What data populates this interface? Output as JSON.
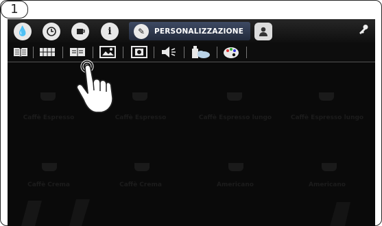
{
  "step_number": "1",
  "header": {
    "tabs": [
      {
        "icon": "water-drop-icon"
      },
      {
        "icon": "clock-icon"
      },
      {
        "icon": "cup-icon"
      },
      {
        "icon": "info-icon"
      }
    ],
    "active_tab": {
      "label": "PERSONALIZZAZIONE",
      "icon": "pencil-icon"
    },
    "user_icon": "user-profile-icon",
    "settings_icon": "wrench-icon"
  },
  "toolbar": {
    "items": [
      {
        "icon": "open-book-icon"
      },
      {
        "icon": "grid-book-icon"
      },
      {
        "icon": "selected-book-icon"
      },
      {
        "icon": "image-icon"
      },
      {
        "icon": "photo-frame-icon"
      },
      {
        "icon": "speaker-icon"
      },
      {
        "icon": "bottle-cloud-icon"
      },
      {
        "icon": "palette-icon"
      }
    ]
  },
  "drinks": [
    {
      "label": "Caffè Espresso"
    },
    {
      "label": "Caffè Espresso"
    },
    {
      "label": "Caffè Espresso lungo"
    },
    {
      "label": "Caffè Espresso lungo"
    },
    {
      "label": "Caffè Crema"
    },
    {
      "label": "Caffè Crema"
    },
    {
      "label": "Americano"
    },
    {
      "label": "Americano"
    }
  ]
}
